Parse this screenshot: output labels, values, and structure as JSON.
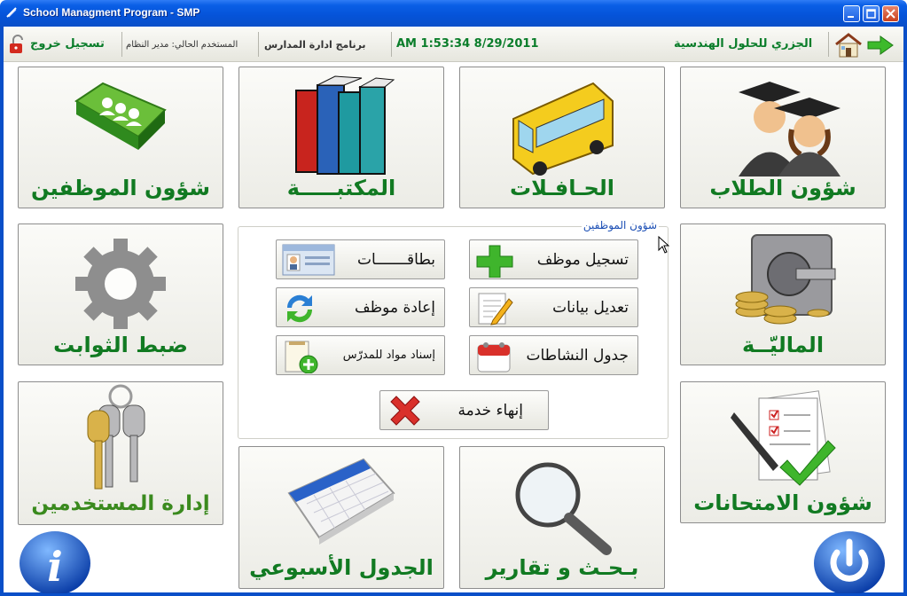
{
  "window": {
    "title": "School Managment Program - SMP"
  },
  "statusbar": {
    "logout_label": "تسجيل خروج",
    "current_user": "المستخدم الحالي: مدير النظام",
    "program_name": "برنامج ادارة المدارس",
    "datetime": "AM 1:53:34 8/29/2011",
    "company": "الجزري للحلول الهندسية"
  },
  "tiles": {
    "employees": "شؤون الموظفين",
    "library": "المكتبـــــة",
    "buses": "الحـافـلات",
    "students": "شؤون الطلاب",
    "settings": "ضبط الثوابت",
    "finance": "الماليّــة",
    "users": "إدارة المستخدمين",
    "exams": "شؤون الامتحانات",
    "schedule": "الجدول الأسبوعي",
    "reports": "بـحـث و تقارير"
  },
  "panel": {
    "title": "شؤون الموظفين",
    "cards": "بطاقـــــــات",
    "register_employee": "تسجيل موظف",
    "rehire_employee": "إعادة موظف",
    "edit_data": "تعديل بيانات",
    "assign_subjects": "إسناد مواد للمدرّس",
    "activities_table": "جدول النشاطات",
    "end_service": "إنهاء خدمة"
  },
  "colors": {
    "accent_green": "#117a22",
    "panel_title_blue": "#1c4fb5",
    "titlebar_blue": "#0553d8"
  }
}
